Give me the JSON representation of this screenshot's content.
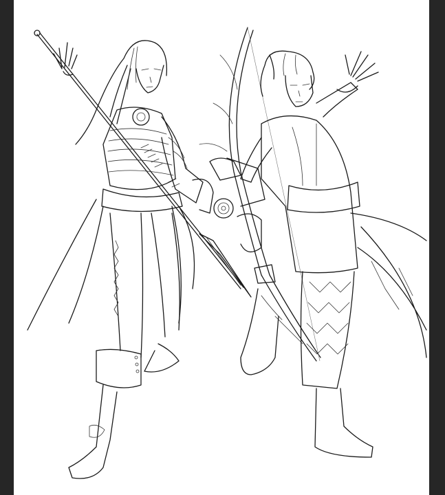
{
  "canvas": {
    "background": "#ffffff",
    "workspace_color": "#2b2b2b",
    "line_color": "#1a1a1a"
  },
  "artwork": {
    "subject_left": "long-haired-figure-with-spear",
    "subject_right": "short-haired-figure-with-bow"
  }
}
